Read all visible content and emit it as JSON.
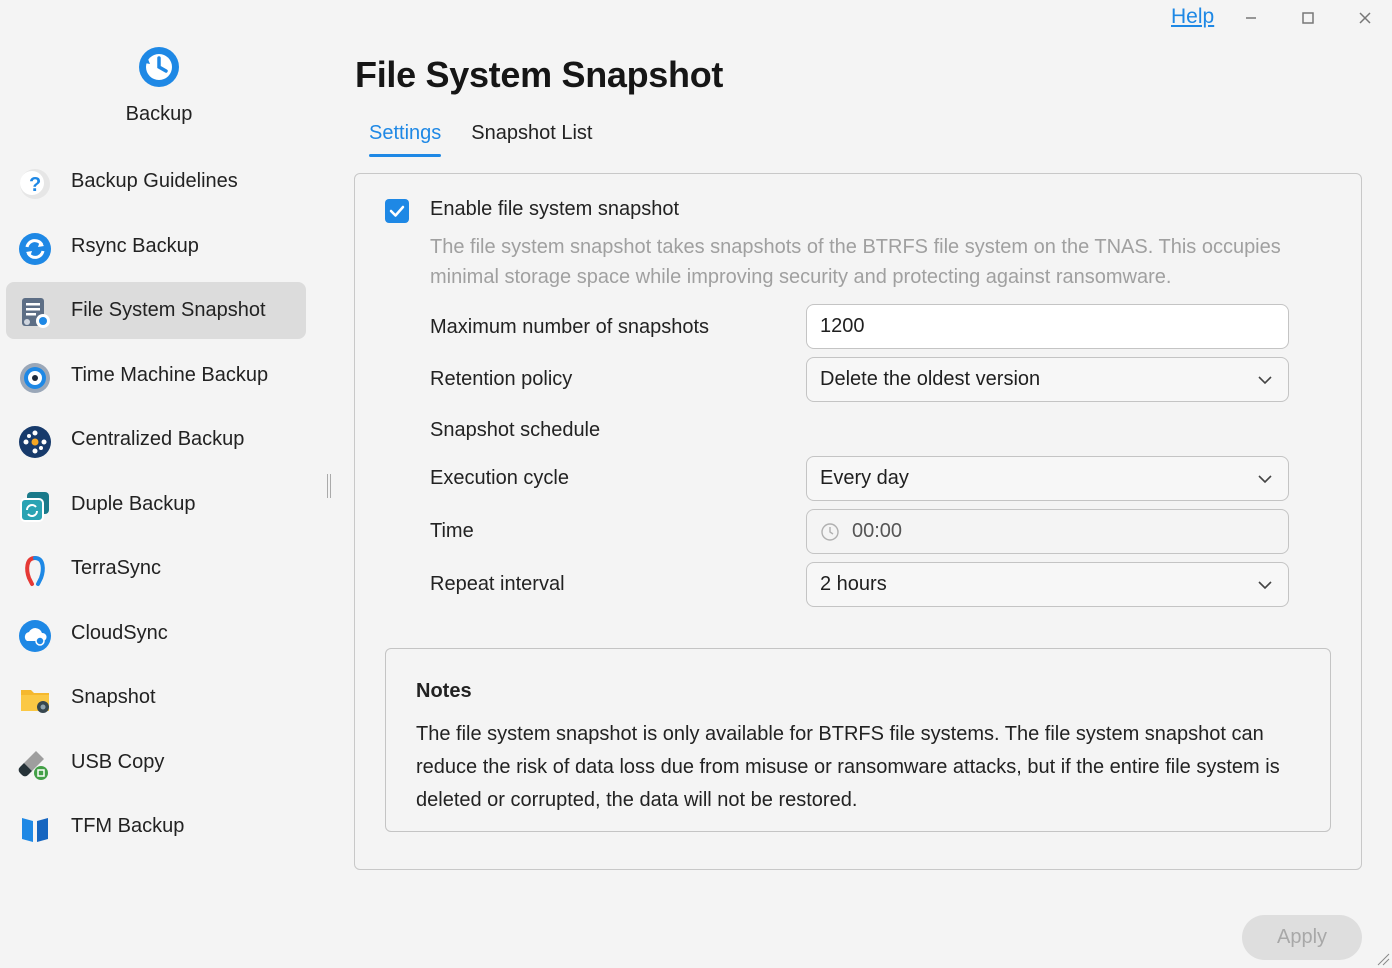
{
  "window": {
    "help_label": "Help",
    "minimize": "–",
    "maximize": "□",
    "close": "✕"
  },
  "sidebar": {
    "app_title": "Backup",
    "items": [
      {
        "label": "Backup Guidelines",
        "icon": "question-icon"
      },
      {
        "label": "Rsync Backup",
        "icon": "rsync-icon"
      },
      {
        "label": "File System Snapshot",
        "icon": "file-system-snapshot-icon",
        "active": true
      },
      {
        "label": "Time Machine Backup",
        "icon": "time-machine-icon"
      },
      {
        "label": "Centralized Backup",
        "icon": "centralized-backup-icon"
      },
      {
        "label": "Duple Backup",
        "icon": "duple-backup-icon"
      },
      {
        "label": "TerraSync",
        "icon": "terrasync-icon"
      },
      {
        "label": "CloudSync",
        "icon": "cloudsync-icon"
      },
      {
        "label": "Snapshot",
        "icon": "snapshot-folder-icon"
      },
      {
        "label": "USB Copy",
        "icon": "usb-copy-icon"
      },
      {
        "label": "TFM Backup",
        "icon": "tfm-backup-icon"
      }
    ]
  },
  "main": {
    "title": "File System Snapshot",
    "tabs": [
      {
        "label": "Settings",
        "active": true
      },
      {
        "label": "Snapshot List",
        "active": false
      }
    ],
    "settings": {
      "enable_label": "Enable file system snapshot",
      "enable_checked": true,
      "description": "The file system snapshot takes snapshots of the BTRFS file system on the TNAS. This occupies minimal storage space while improving security and protecting against ransomware.",
      "max_snapshots_label": "Maximum number of snapshots",
      "max_snapshots_value": "1200",
      "retention_label": "Retention policy",
      "retention_value": "Delete the oldest version",
      "schedule_label": "Snapshot schedule",
      "execution_cycle_label": "Execution cycle",
      "execution_cycle_value": "Every day",
      "time_label": "Time",
      "time_value": "00:00",
      "repeat_interval_label": "Repeat interval",
      "repeat_interval_value": "2 hours"
    },
    "notes": {
      "title": "Notes",
      "body": "The file system snapshot is only available for BTRFS file systems. The file system snapshot can reduce the risk of data loss due from misuse or ransomware attacks, but if the entire file system is deleted or corrupted, the data will not be restored."
    },
    "apply_label": "Apply"
  },
  "colors": {
    "accent": "#1e88e5",
    "active_nav_bg": "#dcdcdc",
    "muted_text": "#a0a0a0",
    "disabled_button_bg": "#dedede"
  }
}
